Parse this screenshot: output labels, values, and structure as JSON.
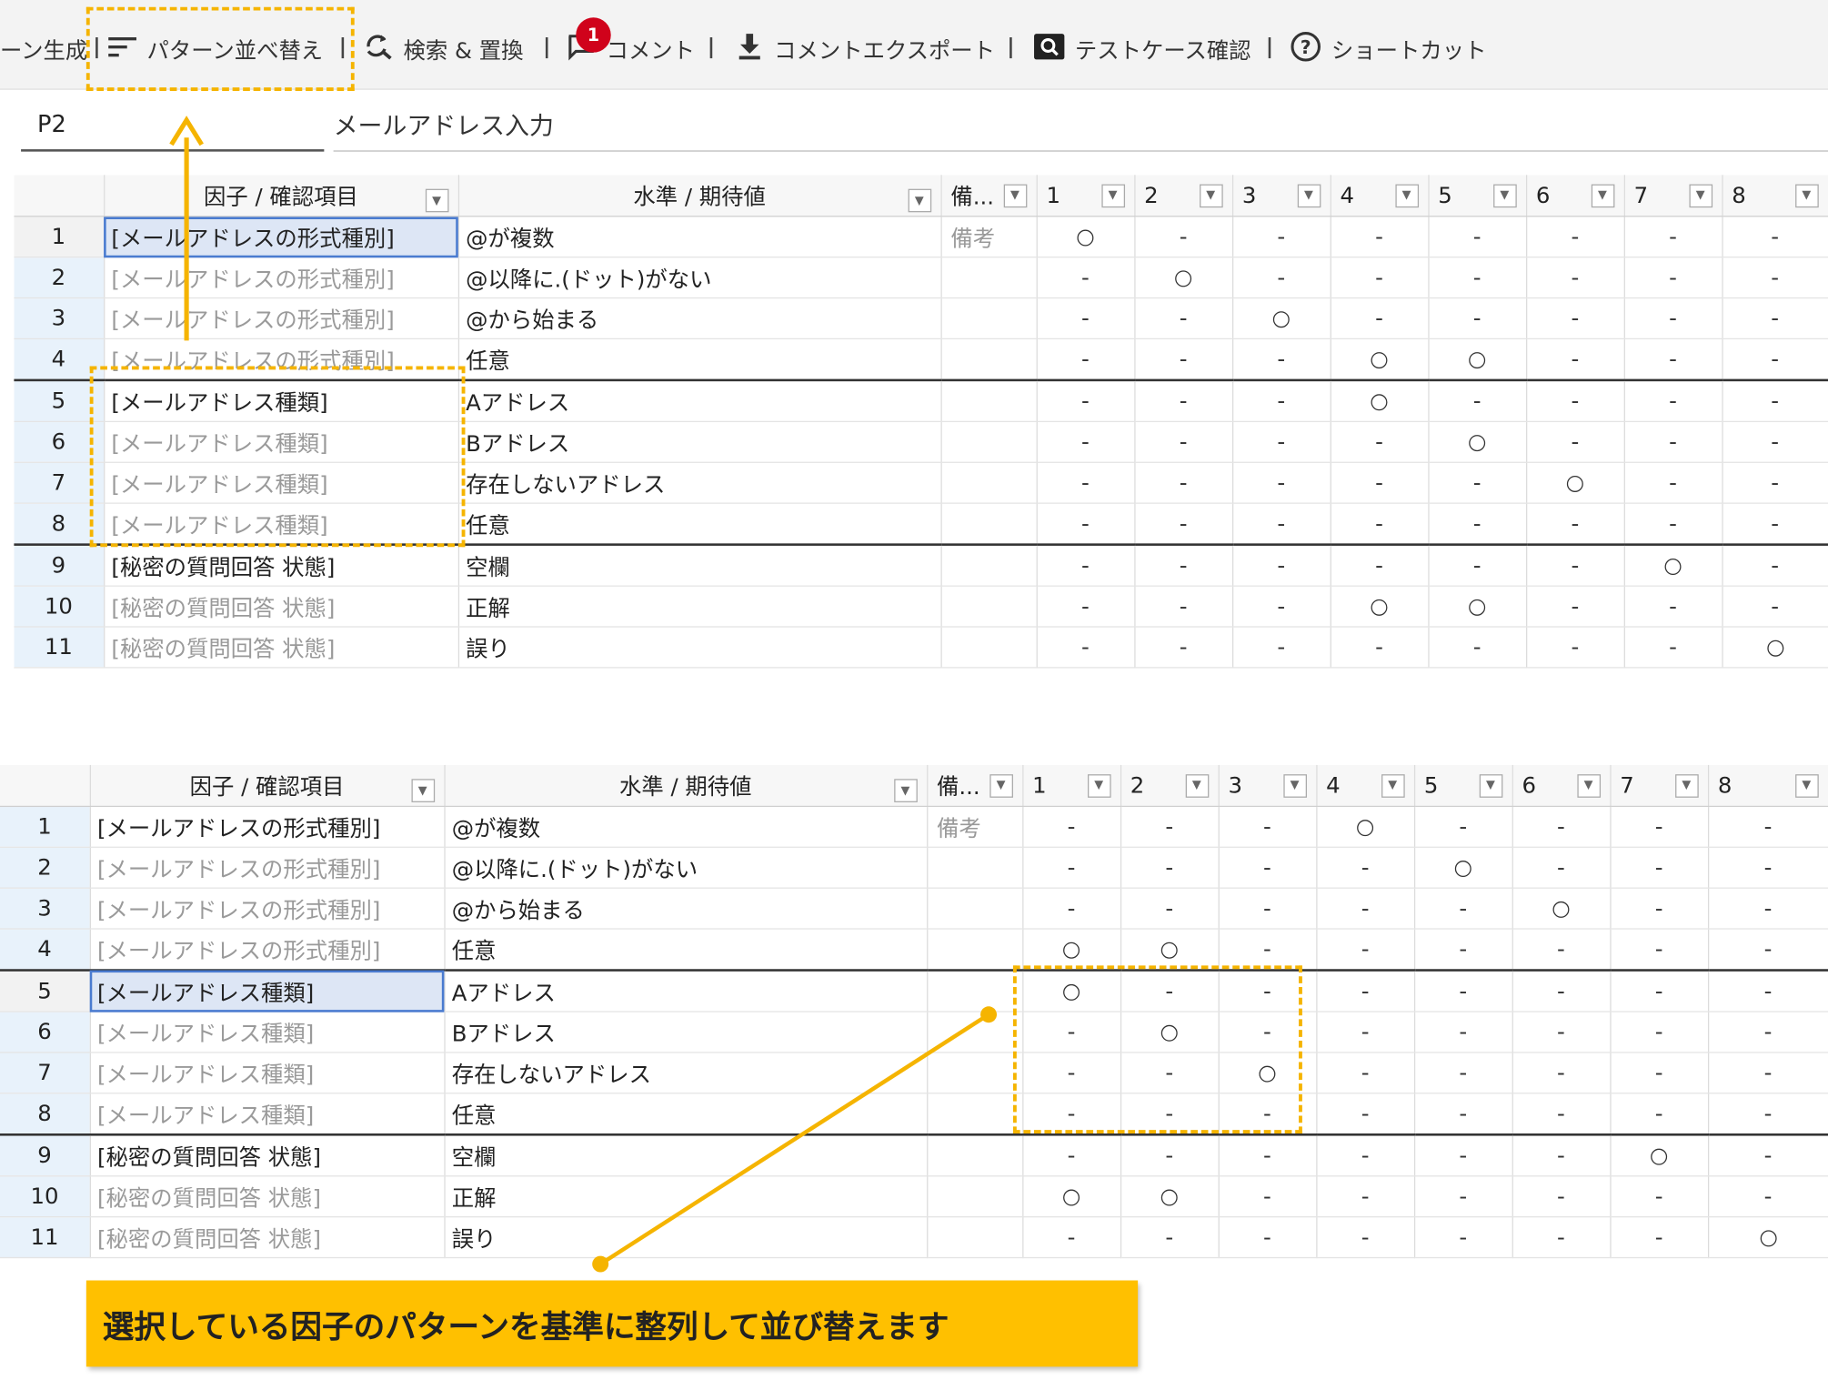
{
  "toolbar": {
    "items": [
      {
        "label": "ーン生成",
        "icon": "generate-icon"
      },
      {
        "label": "パターン並べ替え",
        "icon": "sort-lines-icon"
      },
      {
        "label": "検索 & 置換",
        "icon": "find-replace-icon"
      },
      {
        "label": "コメント",
        "icon": "comment-icon"
      },
      {
        "label": "コメントエクスポート",
        "icon": "download-icon"
      },
      {
        "label": "テストケース確認",
        "icon": "search-box-icon"
      },
      {
        "label": "ショートカット",
        "icon": "help-circle-icon"
      }
    ],
    "comment_badge": "1"
  },
  "pattern": {
    "id": "P2",
    "title": "メールアドレス入力"
  },
  "columns": {
    "factor": "因子 / 確認項目",
    "level": "水準 / 期待値",
    "note": "備...",
    "patterns": [
      "1",
      "2",
      "3",
      "4",
      "5",
      "6",
      "7",
      "8"
    ]
  },
  "table_top": {
    "rows": [
      {
        "n": "1",
        "factor": "[メールアドレスの形式種別]",
        "dim": false,
        "level": "@が複数",
        "note": "備考",
        "marks": [
          "○",
          "-",
          "-",
          "-",
          "-",
          "-",
          "-",
          "-"
        ]
      },
      {
        "n": "2",
        "factor": "[メールアドレスの形式種別]",
        "dim": true,
        "level": "@以降に.(ドット)がない",
        "note": "",
        "marks": [
          "-",
          "○",
          "-",
          "-",
          "-",
          "-",
          "-",
          "-"
        ]
      },
      {
        "n": "3",
        "factor": "[メールアドレスの形式種別]",
        "dim": true,
        "level": "@から始まる",
        "note": "",
        "marks": [
          "-",
          "-",
          "○",
          "-",
          "-",
          "-",
          "-",
          "-"
        ]
      },
      {
        "n": "4",
        "factor": "[メールアドレスの形式種別]",
        "dim": true,
        "level": "任意",
        "note": "",
        "marks": [
          "-",
          "-",
          "-",
          "○",
          "○",
          "-",
          "-",
          "-"
        ]
      },
      {
        "n": "5",
        "factor": "[メールアドレス種類]",
        "dim": false,
        "level": "Aアドレス",
        "note": "",
        "marks": [
          "-",
          "-",
          "-",
          "○",
          "-",
          "-",
          "-",
          "-"
        ]
      },
      {
        "n": "6",
        "factor": "[メールアドレス種類]",
        "dim": true,
        "level": "Bアドレス",
        "note": "",
        "marks": [
          "-",
          "-",
          "-",
          "-",
          "○",
          "-",
          "-",
          "-"
        ]
      },
      {
        "n": "7",
        "factor": "[メールアドレス種類]",
        "dim": true,
        "level": "存在しないアドレス",
        "note": "",
        "marks": [
          "-",
          "-",
          "-",
          "-",
          "-",
          "○",
          "-",
          "-"
        ]
      },
      {
        "n": "8",
        "factor": "[メールアドレス種類]",
        "dim": true,
        "level": "任意",
        "note": "",
        "marks": [
          "-",
          "-",
          "-",
          "-",
          "-",
          "-",
          "-",
          "-"
        ]
      },
      {
        "n": "9",
        "factor": "[秘密の質問回答 状態]",
        "dim": false,
        "level": "空欄",
        "note": "",
        "marks": [
          "-",
          "-",
          "-",
          "-",
          "-",
          "-",
          "○",
          "-"
        ]
      },
      {
        "n": "10",
        "factor": "[秘密の質問回答 状態]",
        "dim": true,
        "level": "正解",
        "note": "",
        "marks": [
          "-",
          "-",
          "-",
          "○",
          "○",
          "-",
          "-",
          "-"
        ]
      },
      {
        "n": "11",
        "factor": "[秘密の質問回答 状態]",
        "dim": true,
        "level": "誤り",
        "note": "",
        "marks": [
          "-",
          "-",
          "-",
          "-",
          "-",
          "-",
          "-",
          "○"
        ]
      }
    ]
  },
  "table_bottom": {
    "rows": [
      {
        "n": "1",
        "factor": "[メールアドレスの形式種別]",
        "dim": false,
        "level": "@が複数",
        "note": "備考",
        "marks": [
          "-",
          "-",
          "-",
          "○",
          "-",
          "-",
          "-",
          "-"
        ]
      },
      {
        "n": "2",
        "factor": "[メールアドレスの形式種別]",
        "dim": true,
        "level": "@以降に.(ドット)がない",
        "note": "",
        "marks": [
          "-",
          "-",
          "-",
          "-",
          "○",
          "-",
          "-",
          "-"
        ]
      },
      {
        "n": "3",
        "factor": "[メールアドレスの形式種別]",
        "dim": true,
        "level": "@から始まる",
        "note": "",
        "marks": [
          "-",
          "-",
          "-",
          "-",
          "-",
          "○",
          "-",
          "-"
        ]
      },
      {
        "n": "4",
        "factor": "[メールアドレスの形式種別]",
        "dim": true,
        "level": "任意",
        "note": "",
        "marks": [
          "○",
          "○",
          "-",
          "-",
          "-",
          "-",
          "-",
          "-"
        ]
      },
      {
        "n": "5",
        "factor": "[メールアドレス種類]",
        "dim": false,
        "level": "Aアドレス",
        "note": "",
        "marks": [
          "○",
          "-",
          "-",
          "-",
          "-",
          "-",
          "-",
          "-"
        ]
      },
      {
        "n": "6",
        "factor": "[メールアドレス種類]",
        "dim": true,
        "level": "Bアドレス",
        "note": "",
        "marks": [
          "-",
          "○",
          "-",
          "-",
          "-",
          "-",
          "-",
          "-"
        ]
      },
      {
        "n": "7",
        "factor": "[メールアドレス種類]",
        "dim": true,
        "level": "存在しないアドレス",
        "note": "",
        "marks": [
          "-",
          "-",
          "○",
          "-",
          "-",
          "-",
          "-",
          "-"
        ]
      },
      {
        "n": "8",
        "factor": "[メールアドレス種類]",
        "dim": true,
        "level": "任意",
        "note": "",
        "marks": [
          "-",
          "-",
          "-",
          "-",
          "-",
          "-",
          "-",
          "-"
        ]
      },
      {
        "n": "9",
        "factor": "[秘密の質問回答 状態]",
        "dim": false,
        "level": "空欄",
        "note": "",
        "marks": [
          "-",
          "-",
          "-",
          "-",
          "-",
          "-",
          "○",
          "-"
        ]
      },
      {
        "n": "10",
        "factor": "[秘密の質問回答 状態]",
        "dim": true,
        "level": "正解",
        "note": "",
        "marks": [
          "○",
          "○",
          "-",
          "-",
          "-",
          "-",
          "-",
          "-"
        ]
      },
      {
        "n": "11",
        "factor": "[秘密の質問回答 状態]",
        "dim": true,
        "level": "誤り",
        "note": "",
        "marks": [
          "-",
          "-",
          "-",
          "-",
          "-",
          "-",
          "-",
          "○"
        ]
      }
    ]
  },
  "callout": {
    "text": "選択している因子のパターンを基準に整列して並び替えます"
  },
  "colors": {
    "accent": "#ffc000",
    "badge": "#d0021b",
    "selected_cell": "#dde6f5",
    "row_number_bg": "#e8f2fb"
  }
}
